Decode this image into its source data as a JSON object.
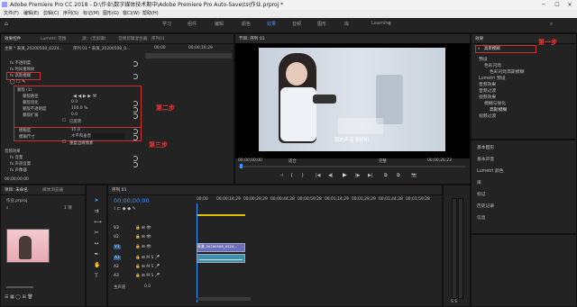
{
  "window": {
    "title": "Adobe Premiere Pro CC 2018 - D:\\作业\\数字媒体技术期中\\Adobe Premiere Pro Auto-Save\\ts\\作业.prproj *",
    "controls": [
      "─",
      "☐",
      "✕"
    ]
  },
  "menu": [
    "文件(F)",
    "编辑(E)",
    "剪辑(C)",
    "序列(S)",
    "标记(M)",
    "图形(G)",
    "窗口(W)",
    "帮助(H)"
  ],
  "workspaces": {
    "items": [
      "学习",
      "组件",
      "编辑",
      "颜色",
      "效果",
      "音频",
      "图形",
      "库",
      "Learning"
    ],
    "active_index": 4
  },
  "effect_controls": {
    "tabs": [
      "效果控件",
      "Lumetri 范围",
      "源：(无剪辑)",
      "音频剪辑混合器：序列01"
    ],
    "source_label": "主要 * 表演_20200508_0224...",
    "seq_label": "序列 01 * 表演_20200508_0...",
    "timecodes": [
      "00;00",
      "00;00;16;29"
    ],
    "sections": [
      "fx 不透明度",
      "fx 时间重映射",
      "fx 高斯模糊"
    ],
    "mask_label": "蒙版 (1)",
    "mask_props": [
      {
        "label": "蒙版路径",
        "value": ""
      },
      {
        "label": "蒙版羽化",
        "value": "0.0"
      },
      {
        "label": "蒙版不透明度",
        "value": "100.0 %"
      },
      {
        "label": "蒙版扩展",
        "value": "0.0"
      }
    ],
    "inverted_label": "已反转",
    "blur_props": [
      {
        "label": "模糊度",
        "value": "15.0"
      },
      {
        "label": "模糊尺寸",
        "value": "水平和垂直"
      }
    ],
    "repeat_label": "重复边缘像素",
    "audio_label": "音频效果",
    "audio_props": [
      "fx 音量",
      "fx 声道音量",
      "fx 声像器"
    ],
    "footer_timecode": "00;00;00;00"
  },
  "program": {
    "tab": "节目: 序列 01",
    "caption": "我的声音很好听",
    "timecode_left": "00;00;00;00",
    "fit_label": "适合",
    "quality_label": "完整",
    "timecode_right": "00;00;26;23",
    "transport": [
      "⊣",
      "{",
      "}",
      "|◀",
      "◀|",
      "▶",
      "|▶",
      "▶|",
      "⧉",
      "⧉",
      "📷"
    ]
  },
  "effects_panel": {
    "tab": "效果",
    "search_value": "高斯模糊",
    "tree": [
      {
        "label": "预设",
        "indent": 0
      },
      {
        "label": "色彩闪烁",
        "indent": 1
      },
      {
        "label": "色彩闪烁高斯模糊",
        "indent": 2
      },
      {
        "label": "Lumetri 预设",
        "indent": 0
      },
      {
        "label": "音频效果",
        "indent": 0
      },
      {
        "label": "音频过渡",
        "indent": 0
      },
      {
        "label": "视频效果",
        "indent": 0
      },
      {
        "label": "模糊与锐化",
        "indent": 1
      },
      {
        "label": "高斯模糊",
        "indent": 2
      },
      {
        "label": "视频过渡",
        "indent": 0
      }
    ],
    "side_items": [
      "基本图形",
      "基本声音",
      "Lumetri 颜色",
      "库",
      "标记",
      "历史记录",
      "信息"
    ]
  },
  "project": {
    "tabs": [
      "项目: 未命名",
      "媒体浏览器"
    ],
    "project_file": "作业.prproj",
    "item_count": "1 项"
  },
  "timeline": {
    "tab": "序列 01",
    "timecode": "00;00;00;00",
    "ruler": [
      "00;00",
      "00;00;14;29",
      "00;00;29;29",
      "00;00;44;28",
      "00;00;59;28",
      "00;01;14;29",
      "00;01;29;29",
      "00;01;44;28",
      "00;01;59;28"
    ],
    "tracks": [
      "V3",
      "V2",
      "V1",
      "A1",
      "A2",
      "A3"
    ],
    "master_label": "主声道",
    "master_value": "0.0",
    "video_clip": "表演_20200508_0224...",
    "audio_clip": ""
  },
  "annotations": {
    "step1": "第一步",
    "step2": "第二步",
    "step3": "第三步"
  },
  "colors": {
    "accent": "#3b95ff",
    "annotation": "#d23030",
    "panel": "#232323"
  }
}
